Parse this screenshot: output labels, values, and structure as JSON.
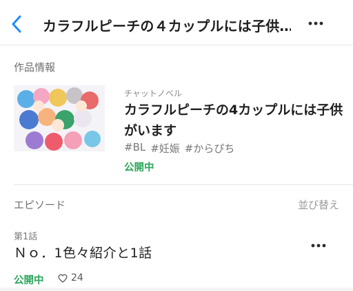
{
  "header": {
    "title": "カラフルピーチの４カップルには子供…",
    "back_icon": "chevron-left-icon",
    "more_icon": "more-horizontal-icon"
  },
  "work_info": {
    "section_label": "作品情報",
    "kind": "チャットノベル",
    "title_line1": "カラフルピーチの4カップルには子供",
    "title_line2": "がいます",
    "tags": [
      "#BL",
      "#妊娠",
      "#からぴち"
    ],
    "status": "公開中",
    "cover_icon": "cover-illustration"
  },
  "episodes": {
    "section_label": "エピソード",
    "sort_label": "並び替え",
    "items": [
      {
        "number": "第1話",
        "title": "Ｎｏ．1色々紹介と1話",
        "status": "公開中",
        "likes": "24",
        "like_icon": "heart-outline-icon",
        "more_icon": "more-horizontal-icon"
      }
    ]
  },
  "colors": {
    "accent": "#1a8cff",
    "status_green": "#2aa65a"
  }
}
